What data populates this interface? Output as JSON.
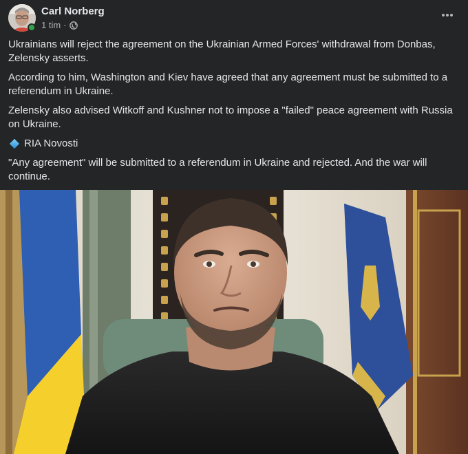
{
  "post": {
    "author": "Carl Norberg",
    "time": "1 tim",
    "separator": "·",
    "audience_icon": "globe-icon",
    "more_icon": "more-dots-icon"
  },
  "content": {
    "paragraphs": [
      "Ukrainians will reject the agreement on the Ukrainian Armed Forces' withdrawal from Donbas, Zelensky asserts.",
      "According to him, Washington and Kiev have agreed that any agreement must be submitted to a referendum in Ukraine.",
      "Zelensky also advised Witkoff and Kushner not to impose a \"failed\" peace agreement with Russia on Ukraine."
    ],
    "source_icon": "blue-diamond-icon",
    "source": "RIA Novosti",
    "closing": "\"Any agreement\" will be submitted to a referendum in Ukraine and rejected. And the war will continue."
  },
  "colors": {
    "background": "#242526",
    "text_primary": "#e4e6eb",
    "text_secondary": "#b0b3b8",
    "online": "#31a24c"
  }
}
